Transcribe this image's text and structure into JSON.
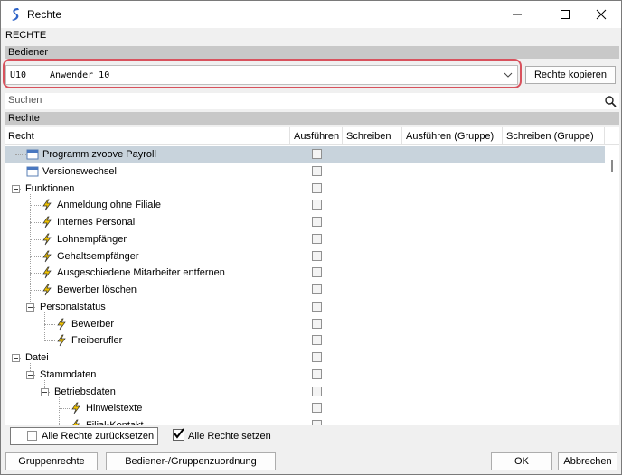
{
  "window": {
    "title": "Rechte"
  },
  "sections": {
    "rechte_top": "RECHTE",
    "bediener": "Bediener",
    "rechte": "Rechte"
  },
  "user_select": {
    "code": "U10",
    "name": "Anwender 10"
  },
  "buttons": {
    "copy_rights": "Rechte kopieren",
    "reset_all": "Alle Rechte zurücksetzen",
    "set_all": "Alle Rechte setzen",
    "group_rights": "Gruppenrechte",
    "user_group_assign": "Bediener-/Gruppenzuordnung",
    "ok": "OK",
    "cancel": "Abbrechen"
  },
  "search": {
    "placeholder": "Suchen"
  },
  "columns": [
    "Recht",
    "Ausführen",
    "Schreiben",
    "Ausführen (Gruppe)",
    "Schreiben (Gruppe)"
  ],
  "tree": [
    {
      "label": "Programm zvoove Payroll",
      "level": 0,
      "type": "window",
      "selected": true
    },
    {
      "label": "Versionswechsel",
      "level": 0,
      "type": "window"
    },
    {
      "label": "Funktionen",
      "level": 0,
      "type": "folder"
    },
    {
      "label": "Anmeldung ohne Filiale",
      "level": 1,
      "type": "function"
    },
    {
      "label": "Internes Personal",
      "level": 1,
      "type": "function"
    },
    {
      "label": "Lohnempfänger",
      "level": 1,
      "type": "function"
    },
    {
      "label": "Gehaltsempfänger",
      "level": 1,
      "type": "function"
    },
    {
      "label": "Ausgeschiedene Mitarbeiter entfernen",
      "level": 1,
      "type": "function"
    },
    {
      "label": "Bewerber löschen",
      "level": 1,
      "type": "function"
    },
    {
      "label": "Personalstatus",
      "level": 1,
      "type": "folder"
    },
    {
      "label": "Bewerber",
      "level": 2,
      "type": "function"
    },
    {
      "label": "Freiberufler",
      "level": 2,
      "type": "function"
    },
    {
      "label": "Datei",
      "level": 0,
      "type": "folder"
    },
    {
      "label": "Stammdaten",
      "level": 1,
      "type": "folder"
    },
    {
      "label": "Betriebsdaten",
      "level": 2,
      "type": "folder"
    },
    {
      "label": "Hinweistexte",
      "level": 3,
      "type": "function"
    },
    {
      "label": "Filial-Kontakt",
      "level": 3,
      "type": "function"
    }
  ],
  "icons": {
    "app": "zvoove-logo-icon",
    "window": "window-icon",
    "function": "lightning-icon",
    "search": "magnifier-icon"
  },
  "colors": {
    "selected_row": "#c8d3dc",
    "highlight": "#d8525d",
    "section_header": "#c8c8c8"
  }
}
